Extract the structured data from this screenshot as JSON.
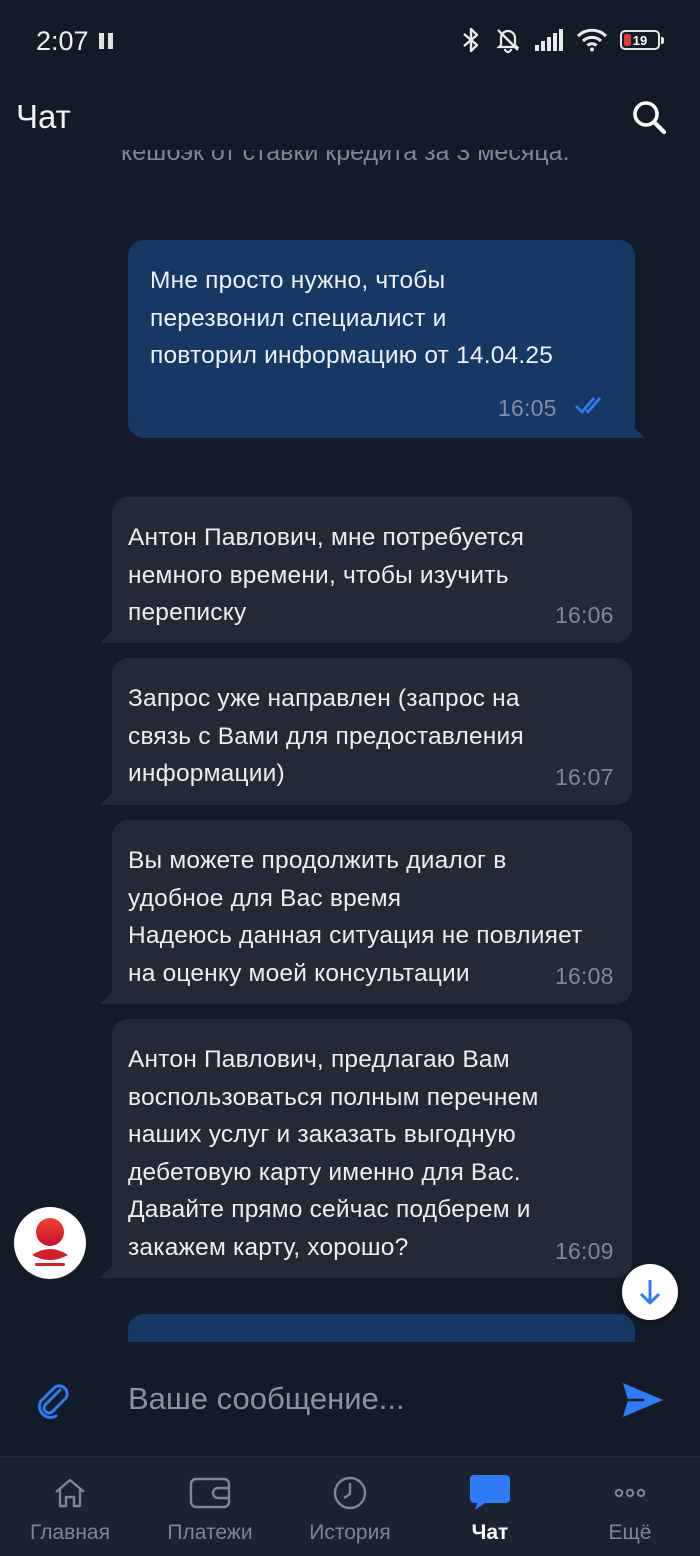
{
  "status_bar": {
    "time": "2:07",
    "battery_level": "19",
    "icons": [
      "pause-icon",
      "bluetooth-icon",
      "bell-muted-icon",
      "signal-icon",
      "wifi-icon",
      "battery-icon"
    ]
  },
  "header": {
    "title": "Чат",
    "search_icon": "search-icon"
  },
  "chat": {
    "partial_text_top": "кешбэк от ставки кредита за 3 месяца.",
    "messages": [
      {
        "direction": "out",
        "text": "Мне просто нужно, чтобы\nперезвонил специалист и\nповторил информацию от 14.04.25",
        "time": "16:05",
        "status_icon": "double-check-icon"
      },
      {
        "direction": "in",
        "text": "Антон Павлович, мне потребуется\nнемного времени, чтобы изучить\nпереписку",
        "time": "16:06"
      },
      {
        "direction": "in",
        "text": "Запрос уже направлен (запрос на\nсвязь с Вами для предоставления\nинформации)",
        "time": "16:07"
      },
      {
        "direction": "in",
        "text": "Вы можете продолжить диалог в\nудобное для Вас время\nНадеюсь данная ситуация не повлияет\nна оценку моей консультации",
        "time": "16:08"
      },
      {
        "direction": "in",
        "text": "Антон Павлович, предлагаю Вам\nвоспользоваться полным перечнем\nнаших услуг и заказать выгодную\nдебетовую карту именно для Вас.\nДавайте прямо сейчас подберем и\nзакажем карту, хорошо?",
        "time": "16:09"
      }
    ]
  },
  "composer": {
    "placeholder": "Ваше сообщение...",
    "attach_icon": "paperclip-icon",
    "send_icon": "send-icon"
  },
  "bottom_nav": {
    "items": [
      {
        "label": "Главная",
        "icon": "home-icon"
      },
      {
        "label": "Платежи",
        "icon": "wallet-icon"
      },
      {
        "label": "История",
        "icon": "clock-icon"
      },
      {
        "label": "Чат",
        "icon": "chat-icon",
        "active": true
      },
      {
        "label": "Ещё",
        "icon": "more-icon"
      }
    ]
  },
  "colors": {
    "background": "#131b28",
    "outgoing_bubble": "#173865",
    "incoming_bubble": "#232a36",
    "accent": "#2f7bf5",
    "brand_red": "#e53935"
  }
}
